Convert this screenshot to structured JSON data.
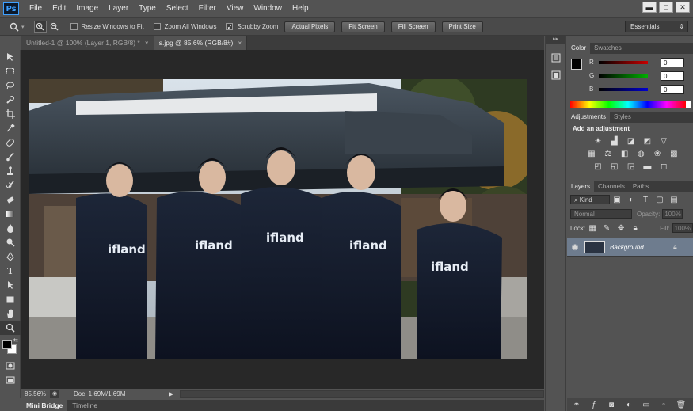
{
  "app": {
    "logo": "Ps"
  },
  "menu": [
    "File",
    "Edit",
    "Image",
    "Layer",
    "Type",
    "Select",
    "Filter",
    "View",
    "Window",
    "Help"
  ],
  "window_controls": {
    "minimize": "▬",
    "restore": "□",
    "close": "✕"
  },
  "options": {
    "resize_windows_label": "Resize Windows to Fit",
    "zoom_all_label": "Zoom All Windows",
    "scrubby_zoom_label": "Scrubby Zoom",
    "actual_pixels": "Actual Pixels",
    "fit_screen": "Fit Screen",
    "fill_screen": "Fill Screen",
    "print_size": "Print Size",
    "workspace": "Essentials"
  },
  "tabs": [
    {
      "label": "Untitled-1 @ 100% (Layer 1, RGB/8) *",
      "close": "×"
    },
    {
      "label": "s.jpg @ 85.6% (RGB/8#)",
      "close": "×"
    }
  ],
  "status": {
    "zoom": "85.56%",
    "doc": "Doc: 1.69M/1.69M"
  },
  "bottom_tabs": [
    "Mini Bridge",
    "Timeline"
  ],
  "color_panel": {
    "tabs": [
      "Color",
      "Swatches"
    ],
    "channels": [
      {
        "label": "R",
        "value": "0",
        "color": "#c80000"
      },
      {
        "label": "G",
        "value": "0",
        "color": "#00b000"
      },
      {
        "label": "B",
        "value": "0",
        "color": "#0000d0"
      }
    ]
  },
  "adjustments_panel": {
    "tabs": [
      "Adjustments",
      "Styles"
    ],
    "heading": "Add an adjustment"
  },
  "layers_panel": {
    "tabs": [
      "Layers",
      "Channels",
      "Paths"
    ],
    "kind": "Kind",
    "blend_mode": "Normal",
    "opacity_label": "Opacity:",
    "opacity_value": "100%",
    "lock_label": "Lock:",
    "fill_label": "Fill:",
    "fill_value": "100%",
    "layers": [
      {
        "name": "Background",
        "visible": true,
        "locked": true
      }
    ]
  },
  "photo": {
    "jerseys": [
      "ifland",
      "ifland",
      "ifland",
      "ifland",
      "ifland"
    ]
  }
}
